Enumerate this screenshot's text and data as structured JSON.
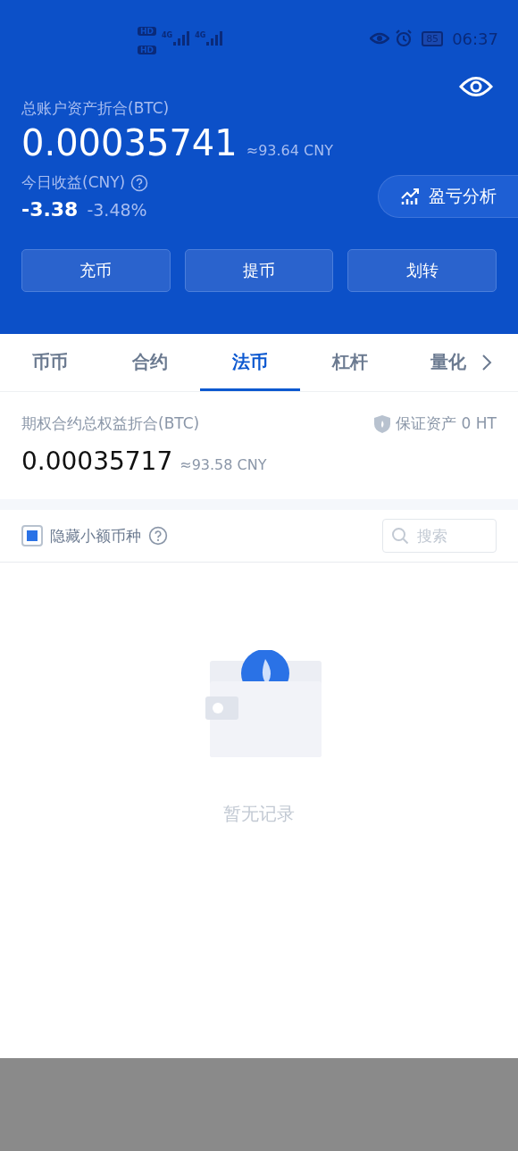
{
  "status_bar": {
    "sims": [
      "HD",
      "HD"
    ],
    "networks": [
      "4G",
      "4G"
    ],
    "battery": "85",
    "time": "06:37"
  },
  "header": {
    "total_label": "总账户资产折合(BTC)",
    "total_value": "0.00035741",
    "total_cny": "≈93.64 CNY",
    "today_label": "今日收益(CNY)",
    "today_value": "-3.38",
    "today_percent": "-3.48%",
    "analysis_button": "盈亏分析",
    "actions": [
      "充币",
      "提币",
      "划转"
    ]
  },
  "tabs": [
    {
      "label": "币币",
      "selected": false
    },
    {
      "label": "合约",
      "selected": false
    },
    {
      "label": "法币",
      "selected": true
    },
    {
      "label": "杠杆",
      "selected": false
    },
    {
      "label": "量化",
      "selected": false
    }
  ],
  "summary": {
    "label": "期权合约总权益折合(BTC)",
    "guarantee": "保证资产 0 HT",
    "value": "0.00035717",
    "cny": "≈93.58 CNY"
  },
  "filter": {
    "hide_small_label": "隐藏小额币种",
    "hide_small_checked": true,
    "search_placeholder": "搜索"
  },
  "empty": {
    "message": "暂无记录"
  }
}
